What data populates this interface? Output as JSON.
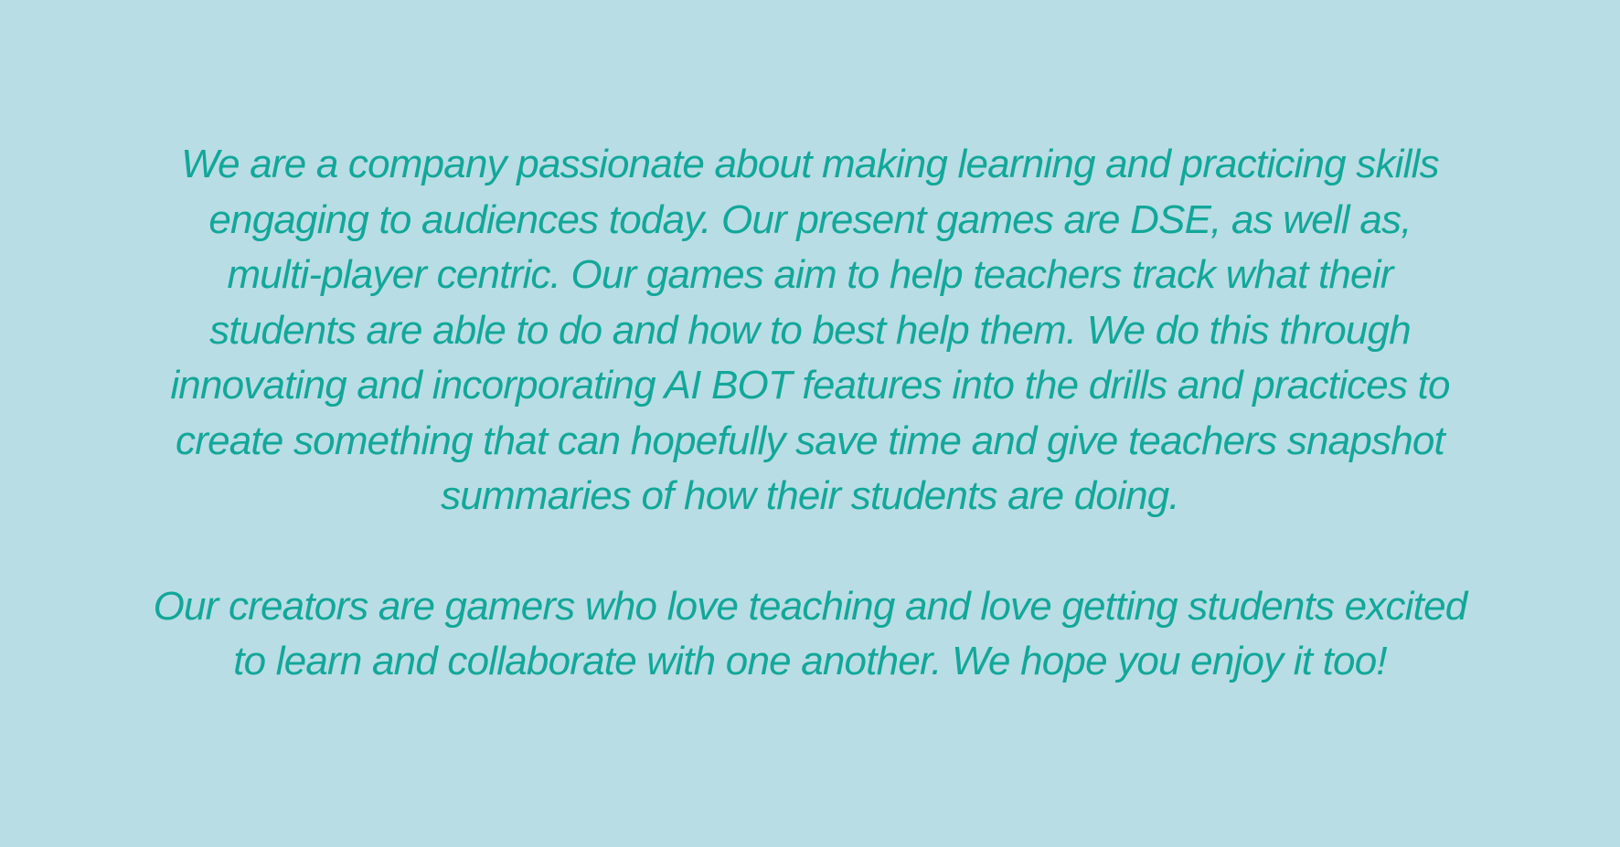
{
  "colors": {
    "background": "#b9dde4",
    "text": "#12a79a"
  },
  "about": {
    "paragraph_1": [
      "We are a company passionate about making learning and practicing skills",
      "engaging to audiences today. Our present games are DSE, as well as,",
      "multi-player centric. Our games aim to help teachers track what their",
      "students are able to do and how to best help them. We do this through",
      "innovating and incorporating AI BOT features into the drills and practices to",
      "create something that can hopefully save time and give teachers snapshot",
      "summaries of how their students are doing."
    ],
    "paragraph_2": [
      "Our creators are gamers who love teaching and love getting students excited",
      "to learn and collaborate with one another. We hope you enjoy it too!"
    ]
  }
}
